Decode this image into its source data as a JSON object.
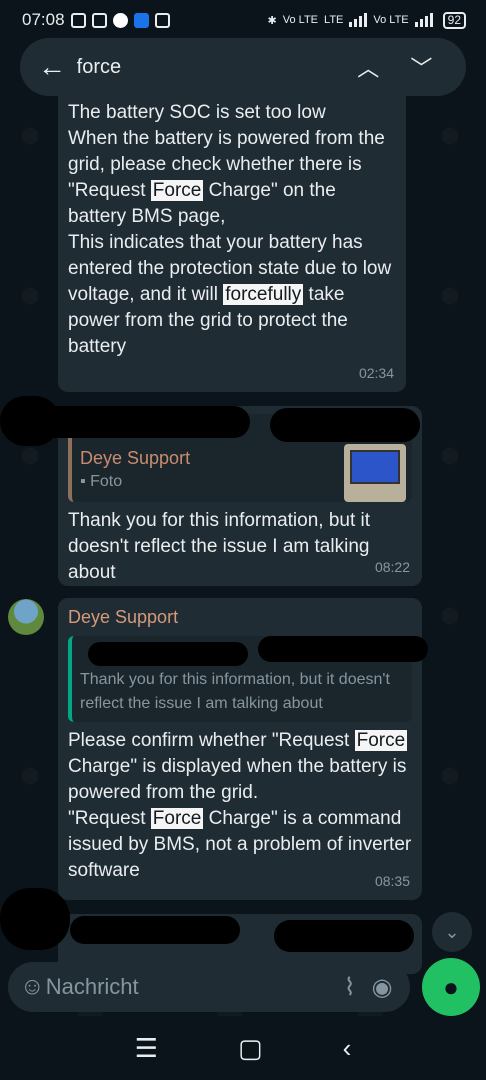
{
  "status_bar": {
    "time": "07:08",
    "network_labels": [
      "Vo LTE",
      "LTE",
      "Vo LTE"
    ],
    "battery": "92"
  },
  "search": {
    "query": "force",
    "icons": [
      "back-arrow-icon",
      "chevron-up-icon",
      "chevron-down-icon"
    ]
  },
  "messages": [
    {
      "id": "msg1",
      "text_parts": [
        "The battery SOC is set too low\nWhen the battery is powered from the grid, please check whether there is \"Request ",
        "Force",
        " Charge\" on the battery BMS page,\nThis indicates that your battery has entered the protection state due to low voltage, and it will ",
        "forcefully",
        " take power from the grid to protect the battery"
      ],
      "time": "02:34"
    },
    {
      "id": "msg2",
      "quote": {
        "name": "Deye Support",
        "text": "Foto"
      },
      "text": "Thank you for this information, but it doesn't reflect the issue I am talking about",
      "time": "08:22"
    },
    {
      "id": "msg3",
      "sender": "Deye Support",
      "quote": {
        "text": "Thank you for this information, but it doesn't reflect the issue I am talking about"
      },
      "text_parts": [
        "Please confirm whether \"Request ",
        "Force",
        " Charge\" is displayed when the battery is powered from the grid.\n\"Request ",
        "Force",
        " Charge\" is a command issued by BMS, not a problem of inverter software"
      ],
      "time": "08:35"
    }
  ],
  "composer": {
    "placeholder": "Nachricht"
  },
  "colors": {
    "background": "#0b141a",
    "bubble": "#202c33",
    "accent": "#21c063",
    "sender": "#d49a7a"
  }
}
